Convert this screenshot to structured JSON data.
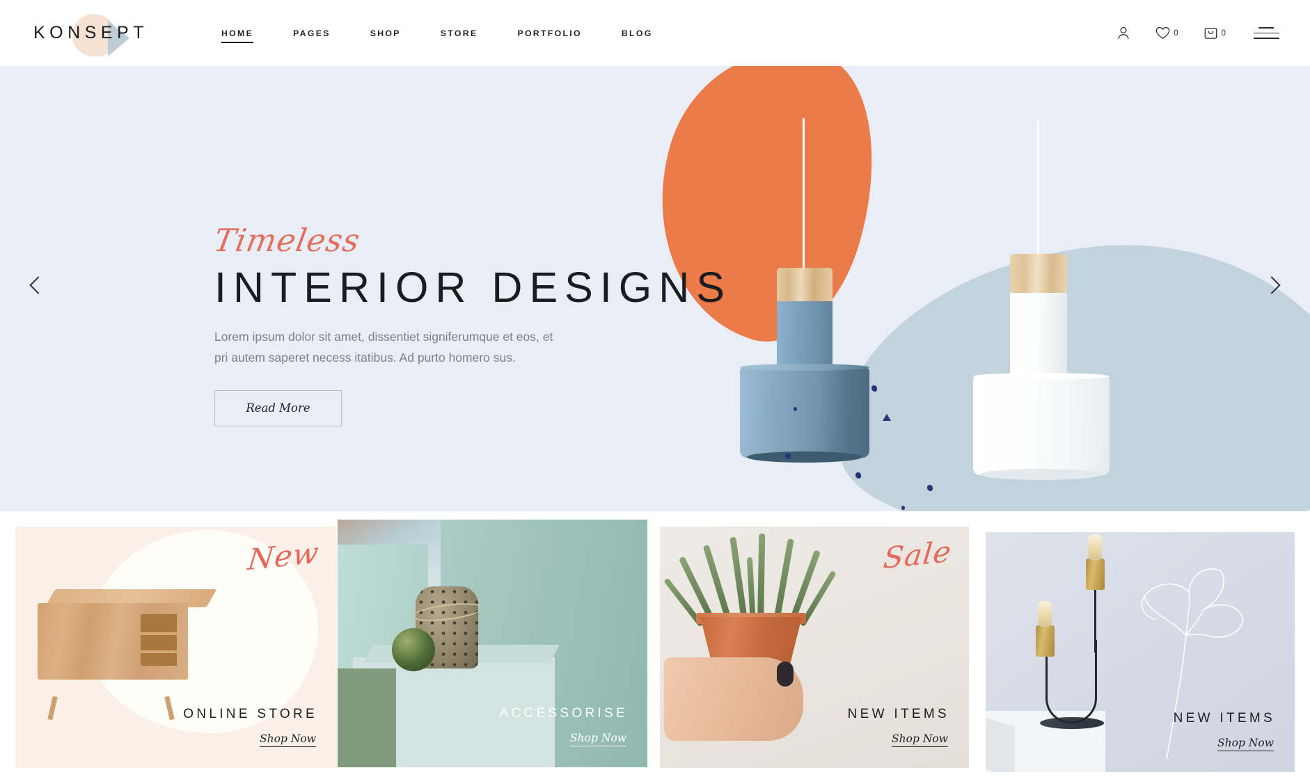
{
  "header": {
    "logo": "KONSEPT",
    "nav": [
      {
        "label": "HOME",
        "active": true
      },
      {
        "label": "PAGES",
        "active": false
      },
      {
        "label": "SHOP",
        "active": false
      },
      {
        "label": "STORE",
        "active": false
      },
      {
        "label": "PORTFOLIO",
        "active": false
      },
      {
        "label": "BLOG",
        "active": false
      }
    ],
    "actions": {
      "account_icon": "user-icon",
      "wishlist_icon": "heart-icon",
      "wishlist_count": "0",
      "cart_icon": "shopping-bag-icon",
      "cart_count": "0",
      "menu_icon": "hamburger-menu-icon"
    }
  },
  "hero": {
    "eyebrow": "Timeless",
    "title": "INTERIOR DESIGNS",
    "subtitle_line1": "Lorem ipsum dolor sit amet, dissentiet signiferumque et eos, et",
    "subtitle_line2": "pri autem saperet necess itatibus. Ad purto homero sus.",
    "cta_label": "Read More",
    "prev_icon": "chevron-left-icon",
    "next_icon": "chevron-right-icon",
    "background_color": "#e9eef6",
    "accent_orange": "#ec7b4a",
    "accent_blue": "#c3d3dd",
    "confetti_color": "#27337a"
  },
  "cards": [
    {
      "id": "card1",
      "badge": "New",
      "label": "ONLINE STORE",
      "shop_label": "Shop Now",
      "background_color": "#faf0e7",
      "text_theme": "dark",
      "image_subject": "wooden-tv-console"
    },
    {
      "id": "card2",
      "badge": "",
      "label": "ACCESSORISE",
      "shop_label": "Shop Now",
      "background_color": "#9fc4bd",
      "text_theme": "light",
      "image_subject": "ceramic-vase-on-pedestal"
    },
    {
      "id": "card3",
      "badge": "Sale",
      "label": "NEW ITEMS",
      "shop_label": "Shop Now",
      "background_color": "#ebe7e1",
      "text_theme": "dark",
      "image_subject": "hand-holding-potted-succulent"
    },
    {
      "id": "card4",
      "badge": "",
      "label": "NEW ITEMS",
      "shop_label": "Shop Now",
      "background_color": "#d7dde7",
      "text_theme": "dark",
      "image_subject": "brass-table-lamp"
    }
  ],
  "colors": {
    "coral": "#e3705f",
    "ink": "#1a1c20",
    "muted": "#7b818a"
  }
}
